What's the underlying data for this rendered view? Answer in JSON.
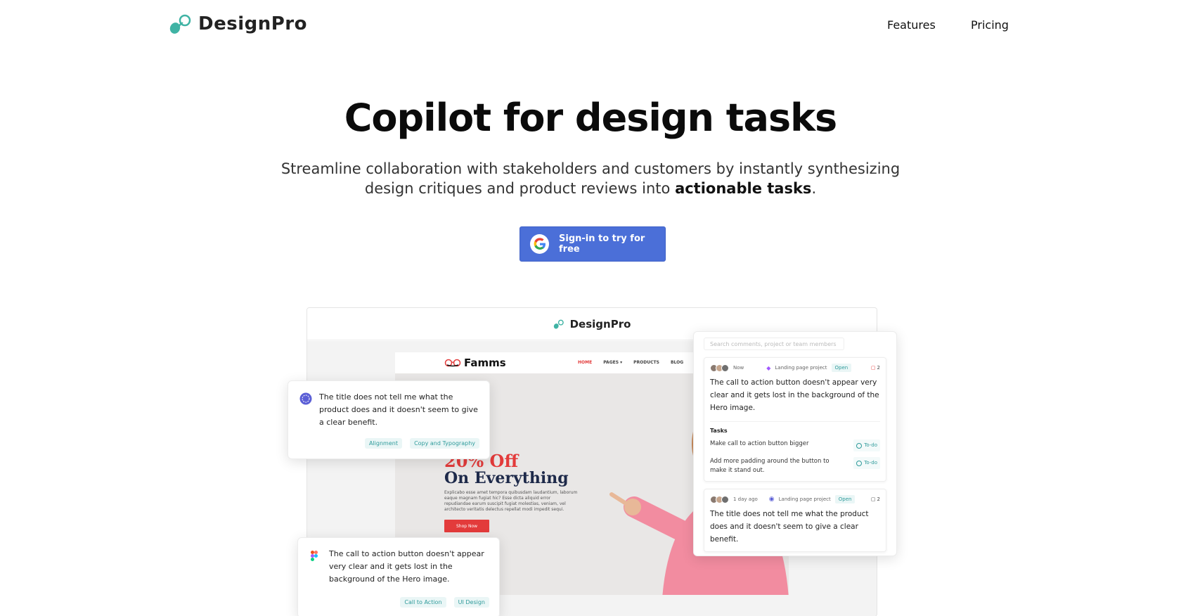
{
  "nav": {
    "logo_text": "DesignPro",
    "links": {
      "features": "Features",
      "pricing": "Pricing"
    }
  },
  "hero": {
    "title": "Copilot for design tasks",
    "subtitle_part1": "Streamline collaboration with stakeholders and customers by instantly synthesizing design critiques and product reviews into ",
    "subtitle_bold": "actionable tasks",
    "subtitle_end": ".",
    "cta_label": "Sign-in to try for free"
  },
  "preview": {
    "app_title": "DesignPro",
    "site": {
      "logo": "Famms",
      "menu": [
        "HOME",
        "PAGES ▾",
        "PRODUCTS",
        "BLOG",
        "C"
      ],
      "headline1": "20% Off",
      "headline2": "On Everything",
      "lorem": "Explicabo esse amet tempora quibusdam laudantium, laborum eaque magnam fugiat hic? Esse dicta aliquid error repudiandae earum suscipit fugiat molestias, veniam, vel architecto veritatis delectus repellat modi impedit sequi.",
      "button": "Shop Now"
    },
    "card1": {
      "text": "The title does not tell me what the product does and it doesn't seem to give a clear benefit.",
      "tags": [
        "Alignment",
        "Copy and Typography"
      ]
    },
    "card2": {
      "text": "The call to action button doesn't appear very clear and it gets lost in the background of the Hero image.",
      "tags": [
        "Call to Action",
        "UI Design"
      ]
    },
    "panel": {
      "search_placeholder": "Search comments, project or team members",
      "comment1": {
        "time": "Now",
        "project": "Landing page project",
        "status": "Open",
        "count": "2",
        "text": "The call to action button doesn't appear very clear and it gets lost in the background of the Hero image.",
        "tasks_heading": "Tasks",
        "tasks": [
          {
            "label": "Make call to action button bigger",
            "status": "To-do"
          },
          {
            "label": "Add more padding around the button to make it stand out.",
            "status": "To-do"
          }
        ]
      },
      "comment2": {
        "time": "1 day ago",
        "project": "Landing page project",
        "status": "Open",
        "count": "2",
        "text": "The title does not tell me what the product does and it doesn't seem to give a clear benefit."
      }
    }
  },
  "colors": {
    "cta": "#4b6fd8",
    "logo_teal": "#3fb3a4",
    "famms_red": "#e33b3b",
    "tag_teal": "#2f9b9b"
  }
}
